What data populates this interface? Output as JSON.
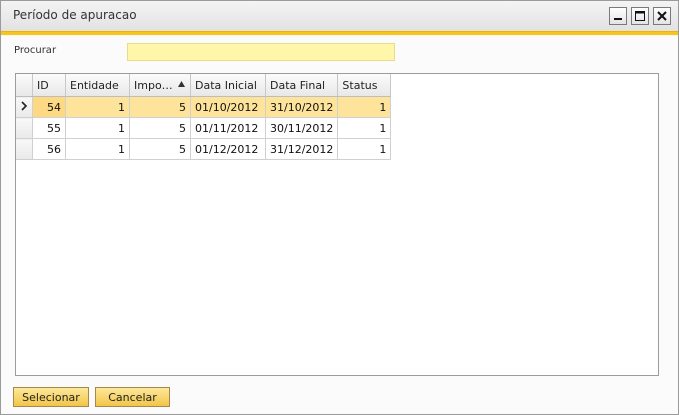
{
  "window": {
    "title": "Período de apuracao"
  },
  "search": {
    "label": "Procurar",
    "value": "",
    "placeholder": ""
  },
  "grid": {
    "columns": [
      "ID",
      "Entidade",
      "Impo…",
      "Data Inicial",
      "Data Final",
      "Status"
    ],
    "sorted_column": "Impo…",
    "sort_direction": "ascending",
    "rows": [
      {
        "id": "54",
        "entidade": "1",
        "impo": "5",
        "data_inicial": "01/10/2012",
        "data_final": "31/10/2012",
        "status": "1",
        "selected": true
      },
      {
        "id": "55",
        "entidade": "1",
        "impo": "5",
        "data_inicial": "01/11/2012",
        "data_final": "30/11/2012",
        "status": "1",
        "selected": false
      },
      {
        "id": "56",
        "entidade": "1",
        "impo": "5",
        "data_inicial": "01/12/2012",
        "data_final": "31/12/2012",
        "status": "1",
        "selected": false
      }
    ]
  },
  "buttons": {
    "select_label": "Selecionar",
    "cancel_label": "Cancelar"
  },
  "colors": {
    "accent": "#f7c61c",
    "search_background": "#fff6a9",
    "selected_row": "#fde49a",
    "button_fill": "#f2c548"
  },
  "icons": {
    "minimize": "minimize-icon",
    "maximize": "maximize-icon",
    "close": "close-icon",
    "row_pointer": "row-pointer-icon",
    "sort": "sort-ascending-icon"
  }
}
